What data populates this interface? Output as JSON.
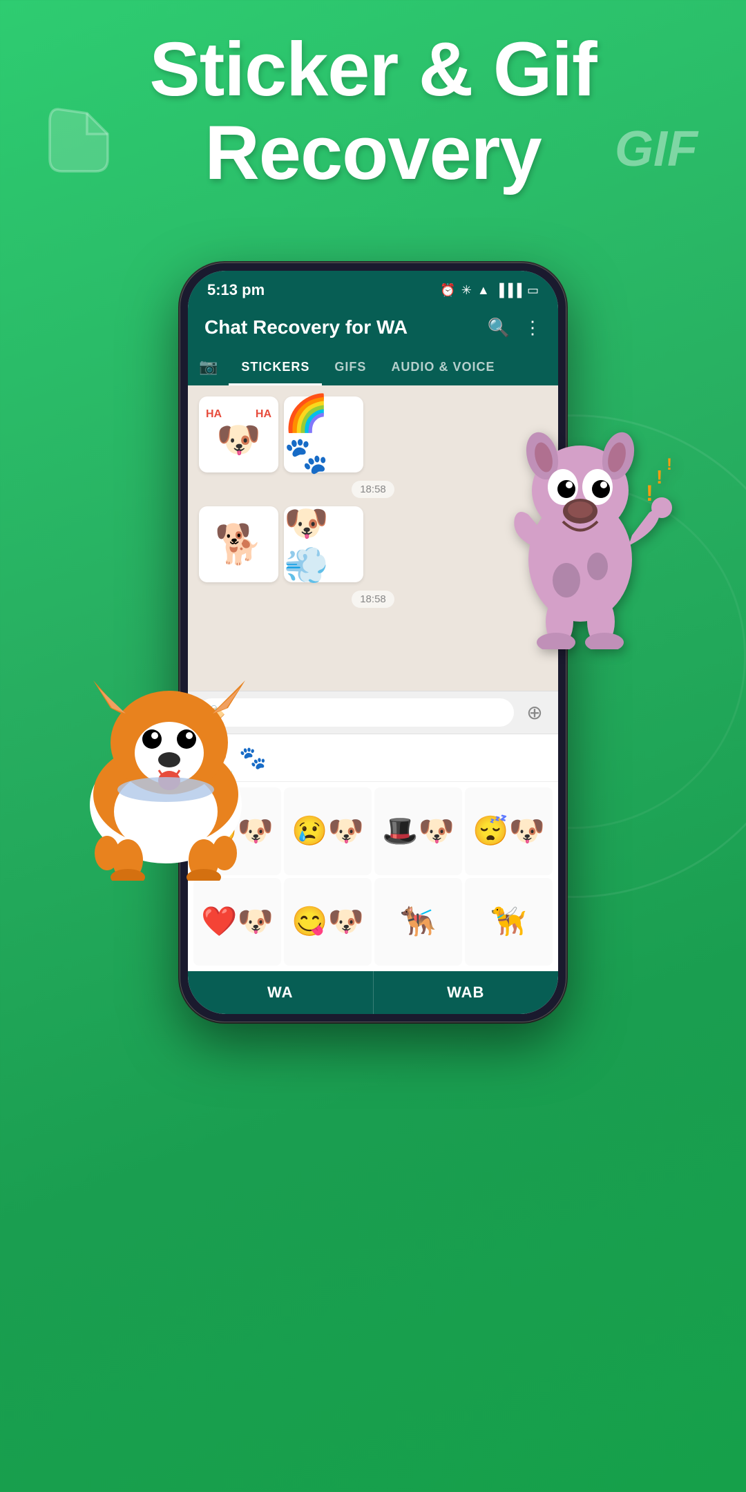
{
  "hero": {
    "line1": "Sticker & Gif",
    "line2": "Recovery",
    "deco_gif": "GIF"
  },
  "phone": {
    "status_bar": {
      "time": "5:13 pm",
      "icons": [
        "⏰",
        "🔷",
        "📶",
        "📶",
        "🔋"
      ]
    },
    "app_bar": {
      "title": "Chat Recovery for WA",
      "search_icon": "🔍",
      "more_icon": "⋮"
    },
    "tabs": {
      "camera_icon": "📷",
      "items": [
        {
          "label": "STICKERS",
          "active": true
        },
        {
          "label": "GIFS",
          "active": false
        },
        {
          "label": "AUDIO & VOICE",
          "active": false
        }
      ]
    },
    "messages": [
      {
        "time": "18:58"
      },
      {
        "time": "18:58"
      }
    ],
    "bottom_nav": {
      "items": [
        {
          "label": "WA"
        },
        {
          "label": "WAB"
        }
      ]
    }
  }
}
